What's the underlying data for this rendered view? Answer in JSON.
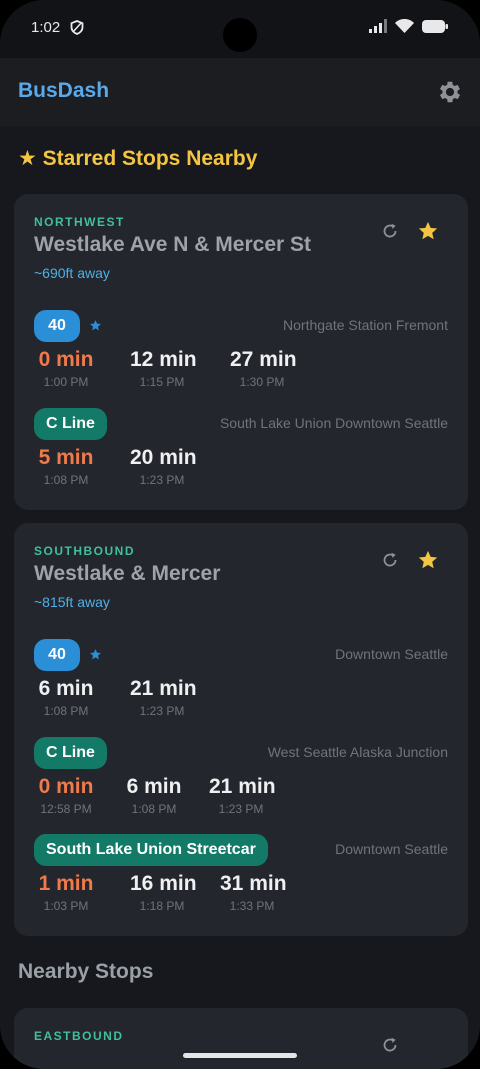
{
  "status_bar": {
    "time": "1:02",
    "icons": [
      "shield-icon",
      "signal-icon",
      "wifi-icon",
      "battery-icon"
    ]
  },
  "app_bar": {
    "title": "BusDash",
    "settings_icon": "gear-icon"
  },
  "colors": {
    "accent_blue": "#5aa9e8",
    "star_gold": "#f4c542",
    "direction_teal": "#3fbf9f",
    "hot_orange": "#f07a4a",
    "badge_blue": "#2a8fd6",
    "badge_teal": "#127a67"
  },
  "starred": {
    "title": "★ Starred Stops Nearby",
    "stops": [
      {
        "direction": "NORTHWEST",
        "name": "Westlake Ave N & Mercer St",
        "distance": "~690ft away",
        "routes": [
          {
            "label": "40",
            "starred": true,
            "destination": "Northgate Station Fremont",
            "arrivals": [
              {
                "min": "0 min",
                "time": "1:00 PM"
              },
              {
                "min": "12 min",
                "time": "1:15 PM"
              },
              {
                "min": "27 min",
                "time": "1:30 PM"
              }
            ]
          },
          {
            "label": "C Line",
            "starred": false,
            "destination": "South Lake Union Downtown Seattle",
            "arrivals": [
              {
                "min": "5 min",
                "time": "1:08 PM"
              },
              {
                "min": "20 min",
                "time": "1:23 PM"
              }
            ]
          }
        ]
      },
      {
        "direction": "SOUTHBOUND",
        "name": "Westlake & Mercer",
        "distance": "~815ft away",
        "routes": [
          {
            "label": "40",
            "starred": true,
            "destination": "Downtown Seattle",
            "arrivals": [
              {
                "min": "6 min",
                "time": "1:08 PM"
              },
              {
                "min": "21 min",
                "time": "1:23 PM"
              }
            ]
          },
          {
            "label": "C Line",
            "starred": false,
            "destination": "West Seattle Alaska Junction",
            "arrivals": [
              {
                "min": "0 min",
                "time": "12:58 PM"
              },
              {
                "min": "6 min",
                "time": "1:08 PM"
              },
              {
                "min": "21 min",
                "time": "1:23 PM"
              }
            ]
          },
          {
            "label": "South Lake Union Streetcar",
            "starred": false,
            "destination": "Downtown Seattle",
            "arrivals": [
              {
                "min": "1 min",
                "time": "1:03 PM"
              },
              {
                "min": "16 min",
                "time": "1:18 PM"
              },
              {
                "min": "31 min",
                "time": "1:33 PM"
              }
            ]
          }
        ]
      }
    ]
  },
  "nearby": {
    "title": "Nearby Stops",
    "stops": [
      {
        "direction": "EASTBOUND"
      }
    ]
  }
}
